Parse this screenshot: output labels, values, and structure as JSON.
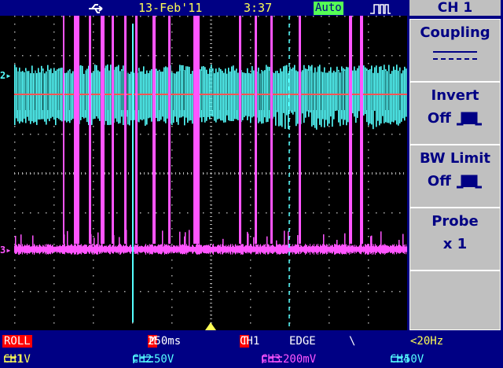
{
  "header": {
    "usb_icon": "usb-icon",
    "date": "13-Feb'11",
    "time": "3:37",
    "mode": "Auto",
    "trigger_icon": "pulse-trigger-icon"
  },
  "markers": {
    "ch2": "2",
    "ch3": "3"
  },
  "menu": {
    "title": "CH 1",
    "coupling": {
      "label": "Coupling",
      "value": "-----"
    },
    "invert": {
      "label": "Invert",
      "value": "Off"
    },
    "bw_limit": {
      "label": "BW Limit",
      "value": "Off"
    },
    "probe": {
      "label": "Probe",
      "value": "x 1"
    }
  },
  "status": {
    "roll": "ROLL",
    "timebase_tag": "M",
    "timebase": "250ms",
    "trigger_tag": "T",
    "trigger_source": "CH1",
    "trigger_type": "EDGE",
    "trigger_slope": "\\",
    "frequency": "<20Hz"
  },
  "channels": [
    {
      "name": "CH1",
      "coupling": "DC",
      "scale": "1V"
    },
    {
      "name": "CH2",
      "coupling": "DC",
      "scale": "50V"
    },
    {
      "name": "CH3",
      "coupling": "DC",
      "scale": "200mV"
    },
    {
      "name": "CH4",
      "coupling": "DC",
      "scale": "50V"
    }
  ],
  "colors": {
    "ch2": "#55ffff",
    "ch3": "#ff55ff",
    "ch3_ref": "#ff5555",
    "grid": "#aaaaaa",
    "panel": "#000084"
  }
}
